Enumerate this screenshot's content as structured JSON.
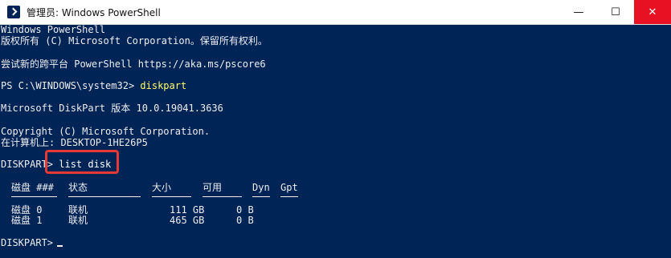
{
  "window": {
    "title": "管理员: Windows PowerShell",
    "icon": "powershell-icon",
    "controls": {
      "minimize": "—",
      "maximize": "☐",
      "close": "✕"
    }
  },
  "console": {
    "banner": [
      "Windows PowerShell",
      "版权所有 (C) Microsoft Corporation。保留所有权利。"
    ],
    "tip": "尝试新的跨平台 PowerShell https://aka.ms/pscore6",
    "ps_prompt": "PS C:\\WINDOWS\\system32> ",
    "ps_command": "diskpart",
    "diskpart_version": "Microsoft DiskPart 版本 10.0.19041.3636",
    "copyright": "Copyright (C) Microsoft Corporation.",
    "computer": "在计算机上: DESKTOP-1HE26P5",
    "diskpart_prompt": "DISKPART> ",
    "diskpart_command": "list disk",
    "table": {
      "headers": [
        "磁盘 ###",
        "状态",
        "大小",
        "可用",
        "Dyn",
        "Gpt"
      ],
      "rows": [
        [
          "磁盘 0",
          "联机",
          "111 GB",
          "0 B",
          "",
          ""
        ],
        [
          "磁盘 1",
          "联机",
          "465 GB",
          "0 B",
          "",
          ""
        ]
      ]
    },
    "final_prompt": "DISKPART> "
  },
  "colors": {
    "background": "#012456",
    "text": "#eeedf0",
    "command": "#ffff66",
    "highlight": "#e53935",
    "close_button": "#e81123"
  }
}
